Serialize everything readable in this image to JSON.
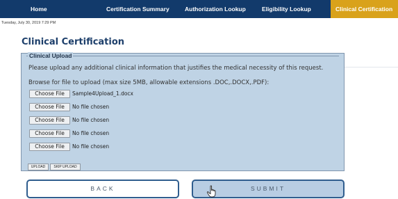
{
  "nav": {
    "items": [
      {
        "label": "Home"
      },
      {
        "label": "Certification Summary"
      },
      {
        "label": "Authorization Lookup"
      },
      {
        "label": "Eligibility Lookup"
      },
      {
        "label": "Clinical Certification"
      }
    ],
    "active": "Clinical Certification",
    "bg_color": "#123a6b",
    "active_color": "#d9a21b"
  },
  "date": "Tuesday, July 30, 2019 7:29 PM",
  "page_title": "Clinical Certification",
  "upload_panel": {
    "legend": "Clinical Upload",
    "info": "Please upload any additional clinical information that justifies the medical necessity of this request.",
    "browse_instructions": "Browse for file to upload (max size 5MB, allowable extensions .DOC,.DOCX,.PDF):",
    "choose_label": "Choose File",
    "files": [
      {
        "name": "Sample4Upload_1.docx"
      },
      {
        "name": "No file chosen"
      },
      {
        "name": "No file chosen"
      },
      {
        "name": "No file chosen"
      },
      {
        "name": "No file chosen"
      }
    ],
    "upload_label": "UPLOAD",
    "skip_upload_label": "SKIP UPLOAD",
    "bg_color": "#bfd3e5"
  },
  "actions": {
    "back_label": "BACK",
    "submit_label": "SUBMIT"
  },
  "cursor_icon": "hand-pointer-icon"
}
